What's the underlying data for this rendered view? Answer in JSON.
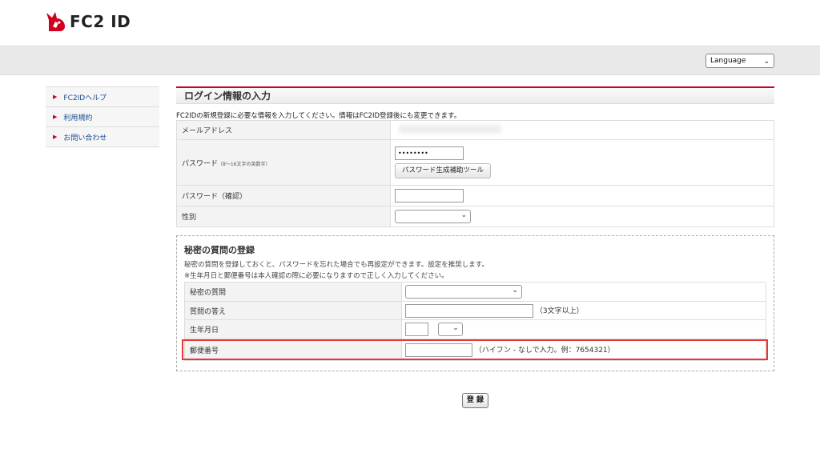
{
  "header": {
    "logo_text": "FC2 ID",
    "language_select": {
      "selected": "Language"
    }
  },
  "sidebar": {
    "items": [
      {
        "label": "FC2IDヘルプ"
      },
      {
        "label": "利用規約"
      },
      {
        "label": "お問い合わせ"
      }
    ]
  },
  "login_section": {
    "title": "ログイン情報の入力",
    "intro": "FC2IDの新規登録に必要な情報を入力してください。情報はFC2ID登録後にも変更できます。",
    "email_label": "メールアドレス",
    "password_label": "パスワード",
    "password_hint": "（8～16文字の英数字）",
    "password_value": "••••••••",
    "password_tool_button": "パスワード生成補助ツール",
    "password_confirm_label": "パスワード（確認）",
    "gender_label": "性別"
  },
  "secret_section": {
    "title": "秘密の質問の登録",
    "description": "秘密の質問を登録しておくと、パスワードを忘れた場合でも再設定ができます。設定を推奨します。",
    "note": "※生年月日と郵便番号は本人確認の際に必要になりますので正しく入力してください。",
    "question_label": "秘密の質問",
    "answer_label": "質問の答え",
    "answer_hint": "（3文字以上）",
    "birthdate_label": "生年月日",
    "postal_label": "郵便番号",
    "postal_hint": "（ハイフン - なしで入力。例：7654321）"
  },
  "submit_label": "登 録",
  "colors": {
    "brand_red": "#d2001f",
    "highlight_red": "#e53935",
    "link_blue": "#1a4d8f"
  }
}
